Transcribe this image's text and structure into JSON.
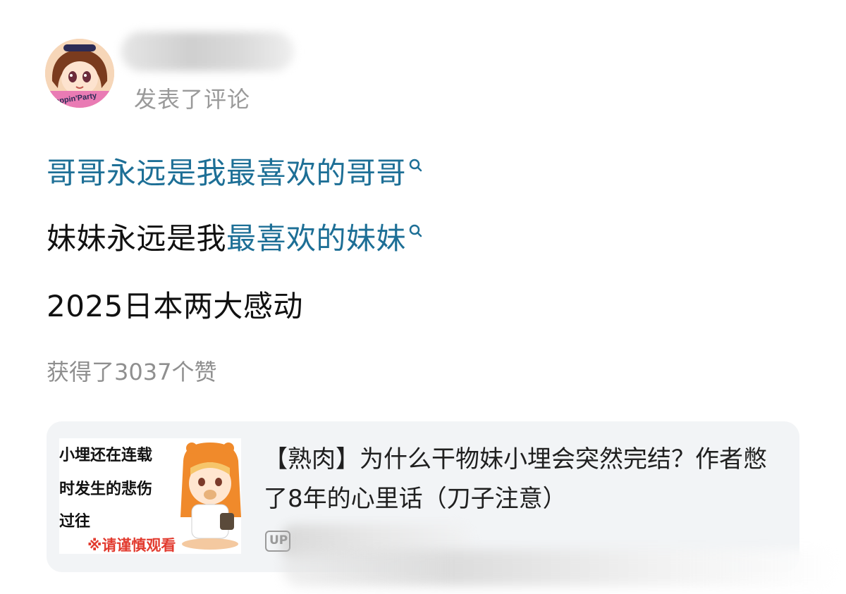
{
  "header": {
    "avatar_badge_text": "Poppin'Party",
    "action_text": "发表了评论"
  },
  "comment": {
    "line1": {
      "link_text": "哥哥永远是我最喜欢的哥哥"
    },
    "line2": {
      "plain_text": "妹妹永远是我",
      "link_text": "最喜欢的妹妹"
    },
    "line3": {
      "plain_text": "2025日本两大感动"
    },
    "likes_text": "获得了3037个赞"
  },
  "card": {
    "thumbnail": {
      "line1": "小埋还在连载",
      "line2": "时发生的悲伤",
      "line3": "过往",
      "warning": "※请谨慎观看"
    },
    "title": "【熟肉】为什么干物妹小埋会突然完结？作者憋了8年的心里话（刀子注意）",
    "uploader_badge": "UP"
  },
  "colors": {
    "link": "#1d6f96",
    "muted": "#9a9a9a",
    "card_bg": "#f2f4f6",
    "warning": "#e23b2f"
  },
  "icons": [
    "search-icon",
    "up-badge-icon"
  ]
}
